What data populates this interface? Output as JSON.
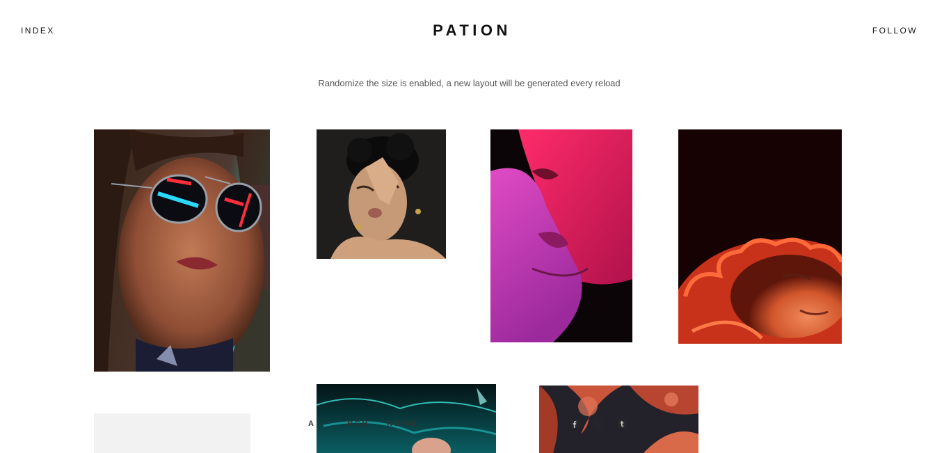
{
  "header": {
    "left_link": "INDEX",
    "logo": "PATION",
    "right_link": "FOLLOW"
  },
  "notice": "Randomize the size is enabled, a new layout will be generated every reload",
  "footer": {
    "nav": [
      "A",
      "",
      "RCH",
      "NDOM"
    ],
    "social_icons": [
      "facebook-icon",
      "instagram-icon",
      "tumblr-icon"
    ]
  },
  "colors": {
    "background": "#ffffff",
    "text": "#111111",
    "muted": "#555555",
    "placeholder": "#f2f2f2"
  }
}
